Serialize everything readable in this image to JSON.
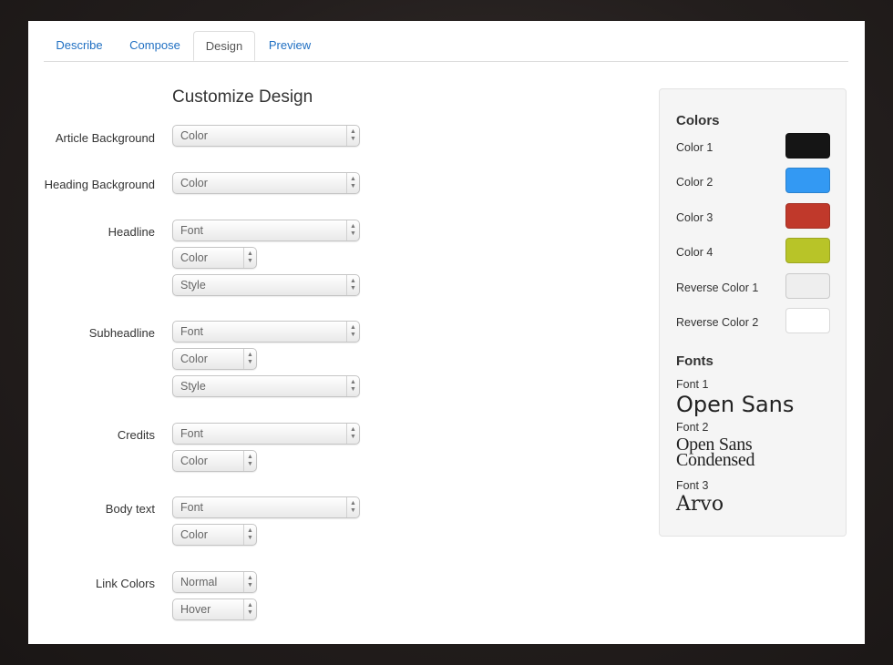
{
  "tabs": [
    {
      "label": "Describe",
      "active": false
    },
    {
      "label": "Compose",
      "active": false
    },
    {
      "label": "Design",
      "active": true
    },
    {
      "label": "Preview",
      "active": false
    }
  ],
  "page_title": "Customize Design",
  "form": {
    "article_background": {
      "label": "Article Background",
      "select": "Color"
    },
    "heading_background": {
      "label": "Heading Background",
      "select": "Color"
    },
    "headline": {
      "label": "Headline",
      "font": "Font",
      "color": "Color",
      "style": "Style"
    },
    "subheadline": {
      "label": "Subheadline",
      "font": "Font",
      "color": "Color",
      "style": "Style"
    },
    "credits": {
      "label": "Credits",
      "font": "Font",
      "color": "Color"
    },
    "body_text": {
      "label": "Body text",
      "font": "Font",
      "color": "Color"
    },
    "link_colors": {
      "label": "Link Colors",
      "normal": "Normal",
      "hover": "Hover"
    }
  },
  "sidebar": {
    "colors_heading": "Colors",
    "colors": [
      {
        "label": "Color 1",
        "hex": "#151515"
      },
      {
        "label": "Color 2",
        "hex": "#3399f3"
      },
      {
        "label": "Color 3",
        "hex": "#c0392b"
      },
      {
        "label": "Color 4",
        "hex": "#b8c428"
      },
      {
        "label": "Reverse Color 1",
        "hex": "#eeeeee"
      },
      {
        "label": "Reverse Color 2",
        "hex": "#ffffff"
      }
    ],
    "fonts_heading": "Fonts",
    "fonts": [
      {
        "label": "Font 1",
        "sample": "Open Sans"
      },
      {
        "label": "Font 2",
        "sample": "Open Sans Condensed"
      },
      {
        "label": "Font 3",
        "sample": "Arvo"
      }
    ]
  },
  "icons": {
    "select_arrows": "select-arrows-icon"
  }
}
